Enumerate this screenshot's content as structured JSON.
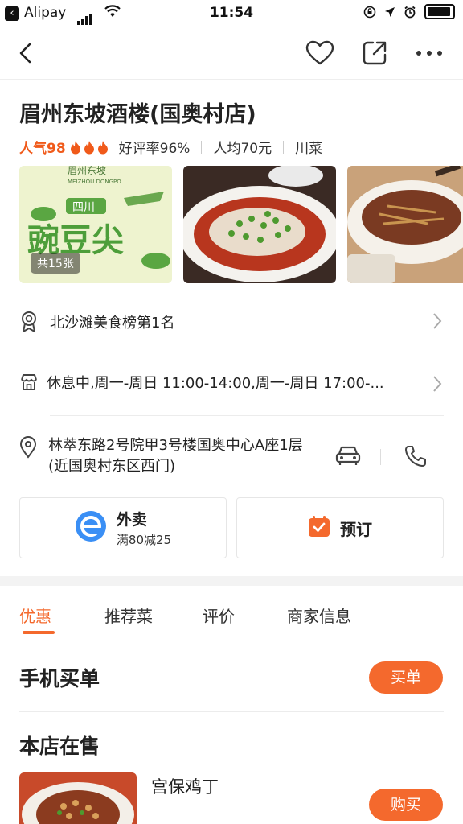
{
  "status_bar": {
    "app": "Alipay",
    "time": "11:54",
    "back_glyph": "‹"
  },
  "nav": {
    "back_icon": "back-arrow-icon",
    "favorite_icon": "heart-icon",
    "share_icon": "share-icon",
    "more_icon": "more-icon"
  },
  "store": {
    "name": "眉州东坡酒楼(国奥村店)",
    "popularity": "人气98",
    "rating": "好评率96%",
    "avg_price": "人均70元",
    "cuisine": "川菜"
  },
  "photos": {
    "count_label": "共15张"
  },
  "info": {
    "ranking": "北沙滩美食榜第1名",
    "hours": "休息中,周一-周日 11:00-14:00,周一-周日 17:00-...",
    "address": "林萃东路2号院甲3号楼国奥中心A座1层(近国奥村东区西门)"
  },
  "actions": {
    "delivery_title": "外卖",
    "delivery_promo": "满80减25",
    "reserve_label": "预订"
  },
  "tabs": [
    "优惠",
    "推荐菜",
    "评价",
    "商家信息"
  ],
  "sections": {
    "pay_title": "手机买单",
    "pay_button": "买单",
    "onsale_title": "本店在售",
    "item_name": "宫保鸡丁",
    "buy_button": "购买"
  },
  "colors": {
    "accent": "#f4692d",
    "popularity": "#f05a1a",
    "delivery": "#3a8ff5"
  }
}
